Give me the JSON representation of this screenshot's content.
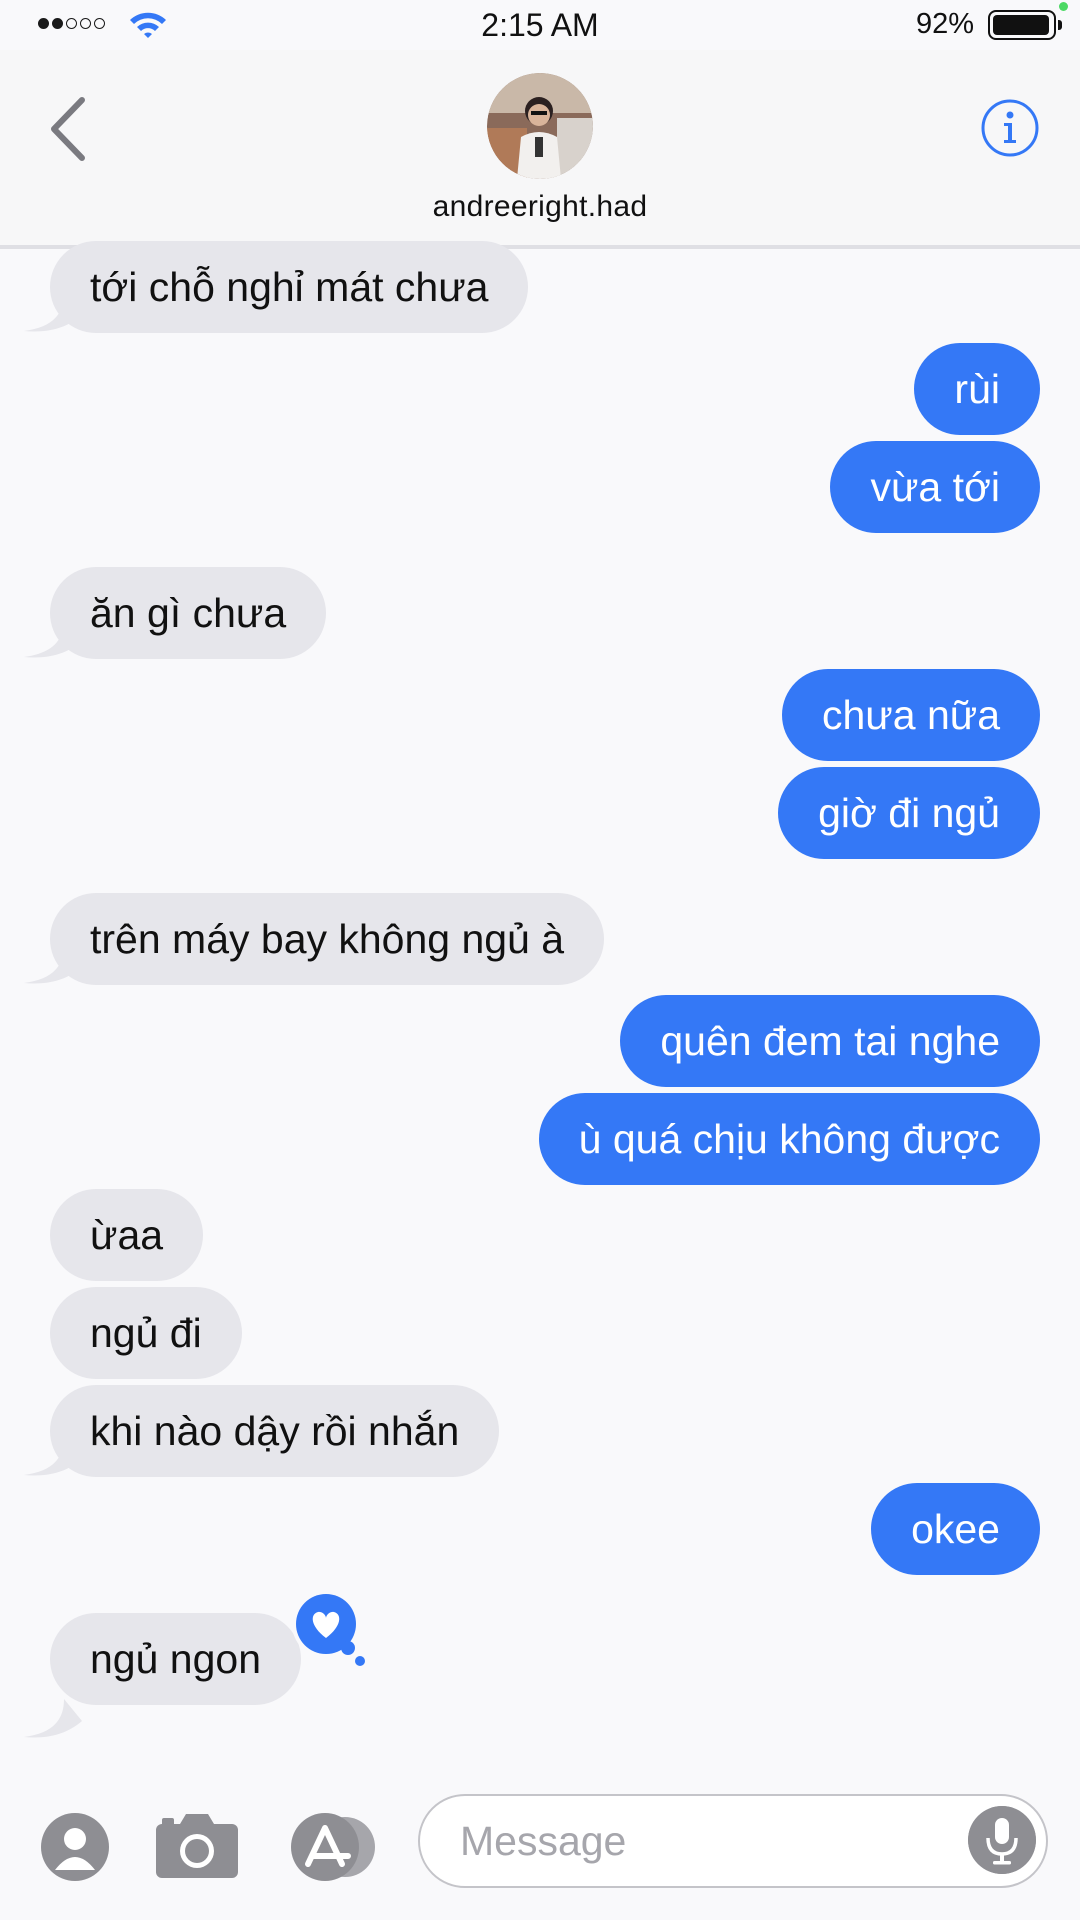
{
  "status_bar": {
    "time": "2:15 AM",
    "battery_percent": "92%",
    "signal_bars": 2,
    "signal_total": 5,
    "battery_level": 0.92
  },
  "header": {
    "contact_name": "andreeright.had",
    "back_icon": "chevron-left-icon",
    "info_icon": "info-icon"
  },
  "messages": [
    {
      "direction": "received",
      "text": "tới chỗ nghỉ mát chưa"
    },
    {
      "direction": "sent",
      "text": "rùi"
    },
    {
      "direction": "sent",
      "text": "vừa tới"
    },
    {
      "direction": "received",
      "text": "ăn gì chưa"
    },
    {
      "direction": "sent",
      "text": "chưa nữa"
    },
    {
      "direction": "sent",
      "text": "giờ đi ngủ"
    },
    {
      "direction": "received",
      "text": "trên máy bay không ngủ à"
    },
    {
      "direction": "sent",
      "text": "quên đem tai nghe"
    },
    {
      "direction": "sent",
      "text": "ù quá chịu không được"
    },
    {
      "direction": "received",
      "text": "ừaa"
    },
    {
      "direction": "received",
      "text": "ngủ đi"
    },
    {
      "direction": "received",
      "text": "khi nào dậy rồi nhắn"
    },
    {
      "direction": "sent",
      "text": "okee"
    },
    {
      "direction": "received",
      "text": "ngủ ngon",
      "reaction": "heart-icon"
    }
  ],
  "composer": {
    "placeholder": "Message",
    "tools": [
      "contact-icon",
      "camera-icon",
      "app-store-icon"
    ],
    "mic_icon": "microphone-icon"
  },
  "colors": {
    "sent_bubble": "#3478f6",
    "received_bubble": "#e6e6eb",
    "accent": "#3478f6",
    "background": "#f9f9fb"
  }
}
